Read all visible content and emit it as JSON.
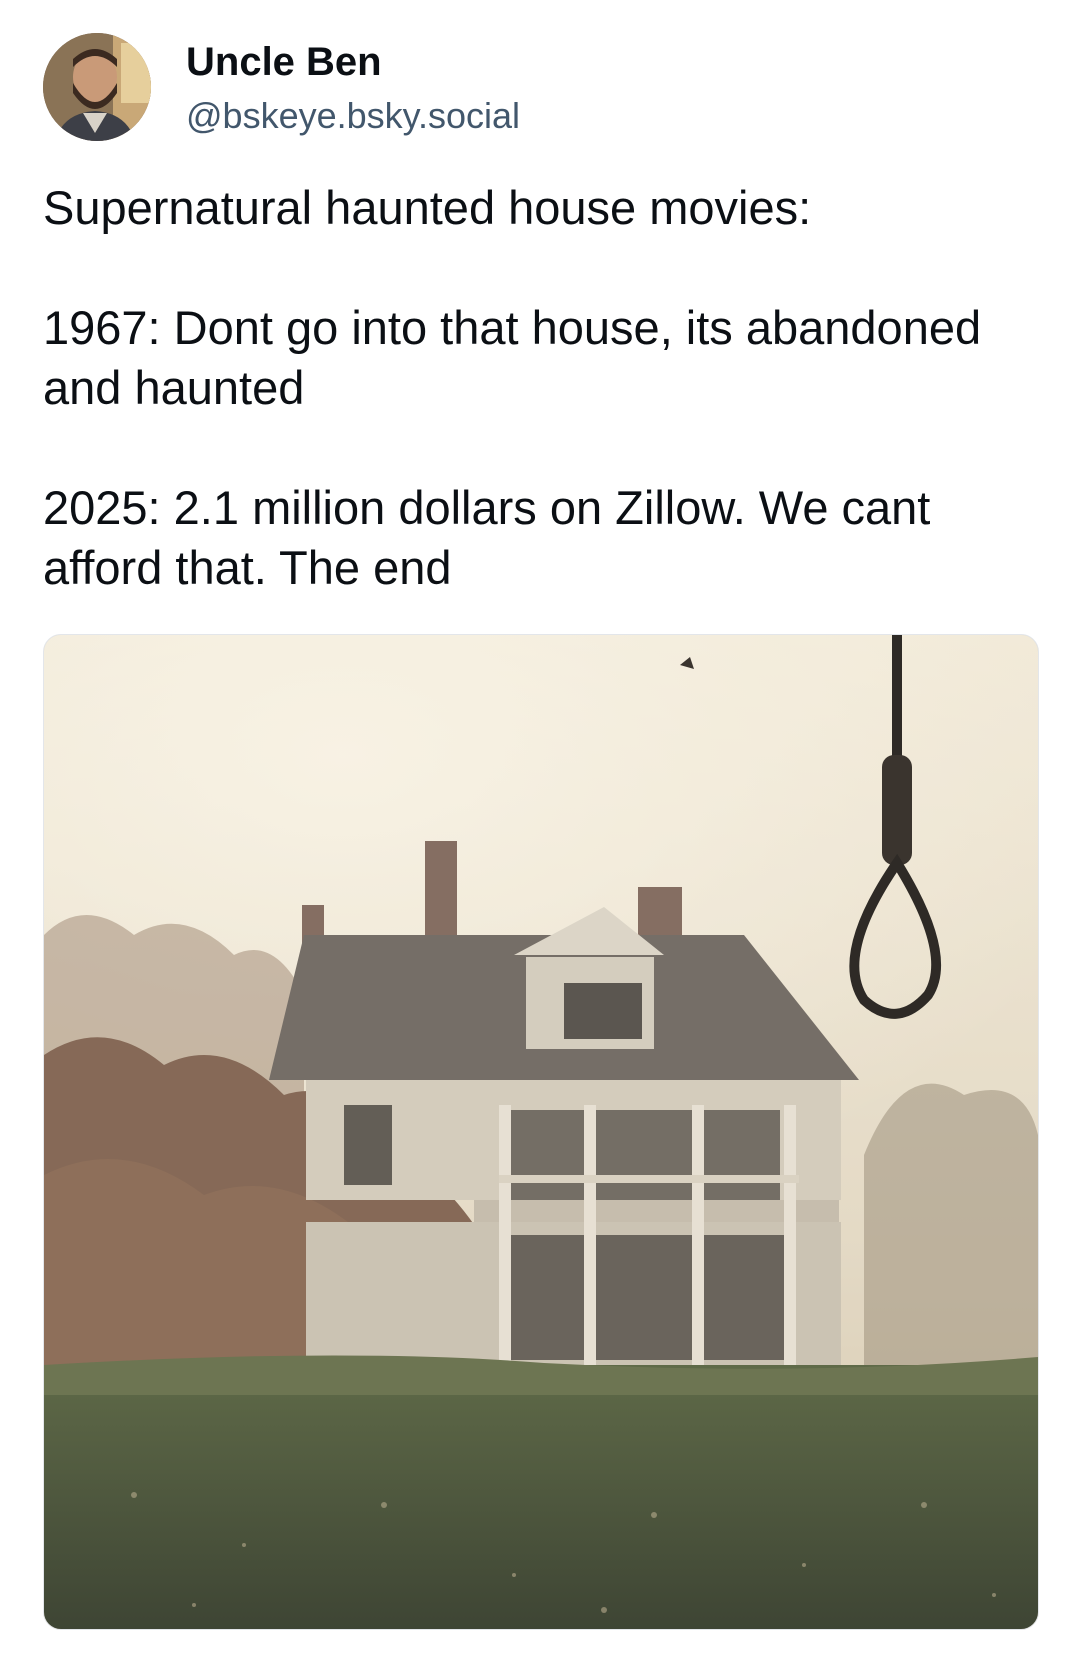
{
  "author": {
    "display_name": "Uncle Ben",
    "handle": "@bskeye.bsky.social",
    "avatar_icon": "user-avatar-photo"
  },
  "post": {
    "paragraphs": [
      "Supernatural haunted house movies:",
      "1967: Dont go into that house, its abandoned and haunted",
      "2025: 2.1 million dollars on Zillow. We cant afford that. The end"
    ]
  },
  "media": {
    "icon": "haunted-house-photo"
  },
  "colors": {
    "text_primary": "#0b0f14",
    "text_secondary": "#42576c",
    "background": "#ffffff"
  }
}
